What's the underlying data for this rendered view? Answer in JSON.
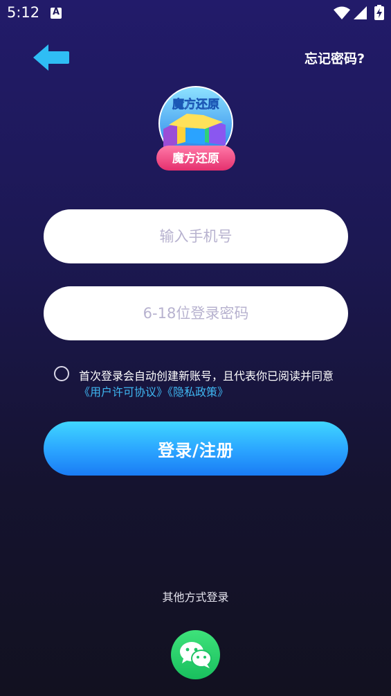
{
  "status_bar": {
    "time": "5:12",
    "notification_glyph": "A"
  },
  "header": {
    "forgot_label": "忘记密码?",
    "back_icon": "back-arrow-icon"
  },
  "logo": {
    "top_text": "魔方还原",
    "badge_text": "魔方还原"
  },
  "form": {
    "phone_placeholder": "输入手机号",
    "password_placeholder": "6-18位登录密码"
  },
  "agreement": {
    "text": "首次登录会自动创建新账号，且代表你已阅读并同意",
    "user_license": "《用户许可协议》",
    "privacy_policy": "《隐私政策》"
  },
  "login_button": "登录/注册",
  "other_login": {
    "label": "其他方式登录",
    "wechat_icon": "wechat-icon"
  },
  "colors": {
    "accent": "#3fb7f2",
    "button": "#2aa3ff",
    "wechat": "#1fc466"
  }
}
